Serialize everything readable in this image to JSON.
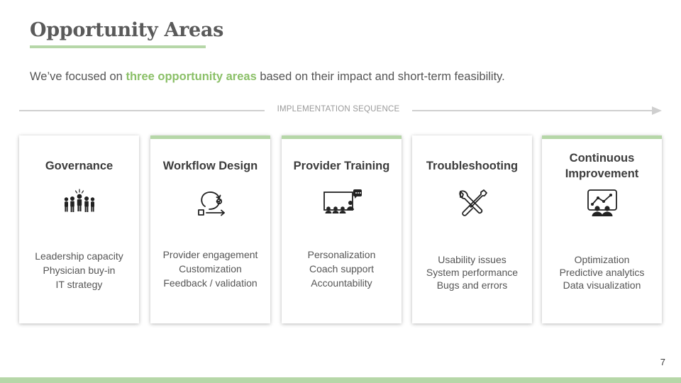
{
  "slide": {
    "title": "Opportunity Areas",
    "intro": {
      "before": "We’ve focused on ",
      "highlight": "three opportunity areas",
      "after": " based on their impact and short-term feasibility."
    },
    "sequence_label": "IMPLEMENTATION SEQUENCE",
    "page_number": "7",
    "accent_color": "#b6d7a8",
    "highlight_color": "#8bc068"
  },
  "cards": [
    {
      "title": "Governance",
      "icon": "leadership-group-icon",
      "accent": false,
      "items": [
        "Leadership capacity",
        "Physician buy-in",
        "IT strategy"
      ]
    },
    {
      "title": "Workflow Design",
      "icon": "workflow-cycle-icon",
      "accent": true,
      "items": [
        "Provider engagement",
        "Customization",
        "Feedback / validation"
      ]
    },
    {
      "title": "Provider Training",
      "icon": "presentation-training-icon",
      "accent": true,
      "items": [
        "Personalization",
        "Coach support",
        "Accountability"
      ]
    },
    {
      "title": "Troubleshooting",
      "icon": "wrench-screwdriver-icon",
      "accent": false,
      "items": [
        "Usability issues",
        "System performance",
        "Bugs and errors"
      ]
    },
    {
      "title": "Continuous Improvement",
      "icon": "analytics-board-icon",
      "accent": true,
      "items": [
        "Optimization",
        "Predictive analytics",
        "Data visualization"
      ]
    }
  ]
}
